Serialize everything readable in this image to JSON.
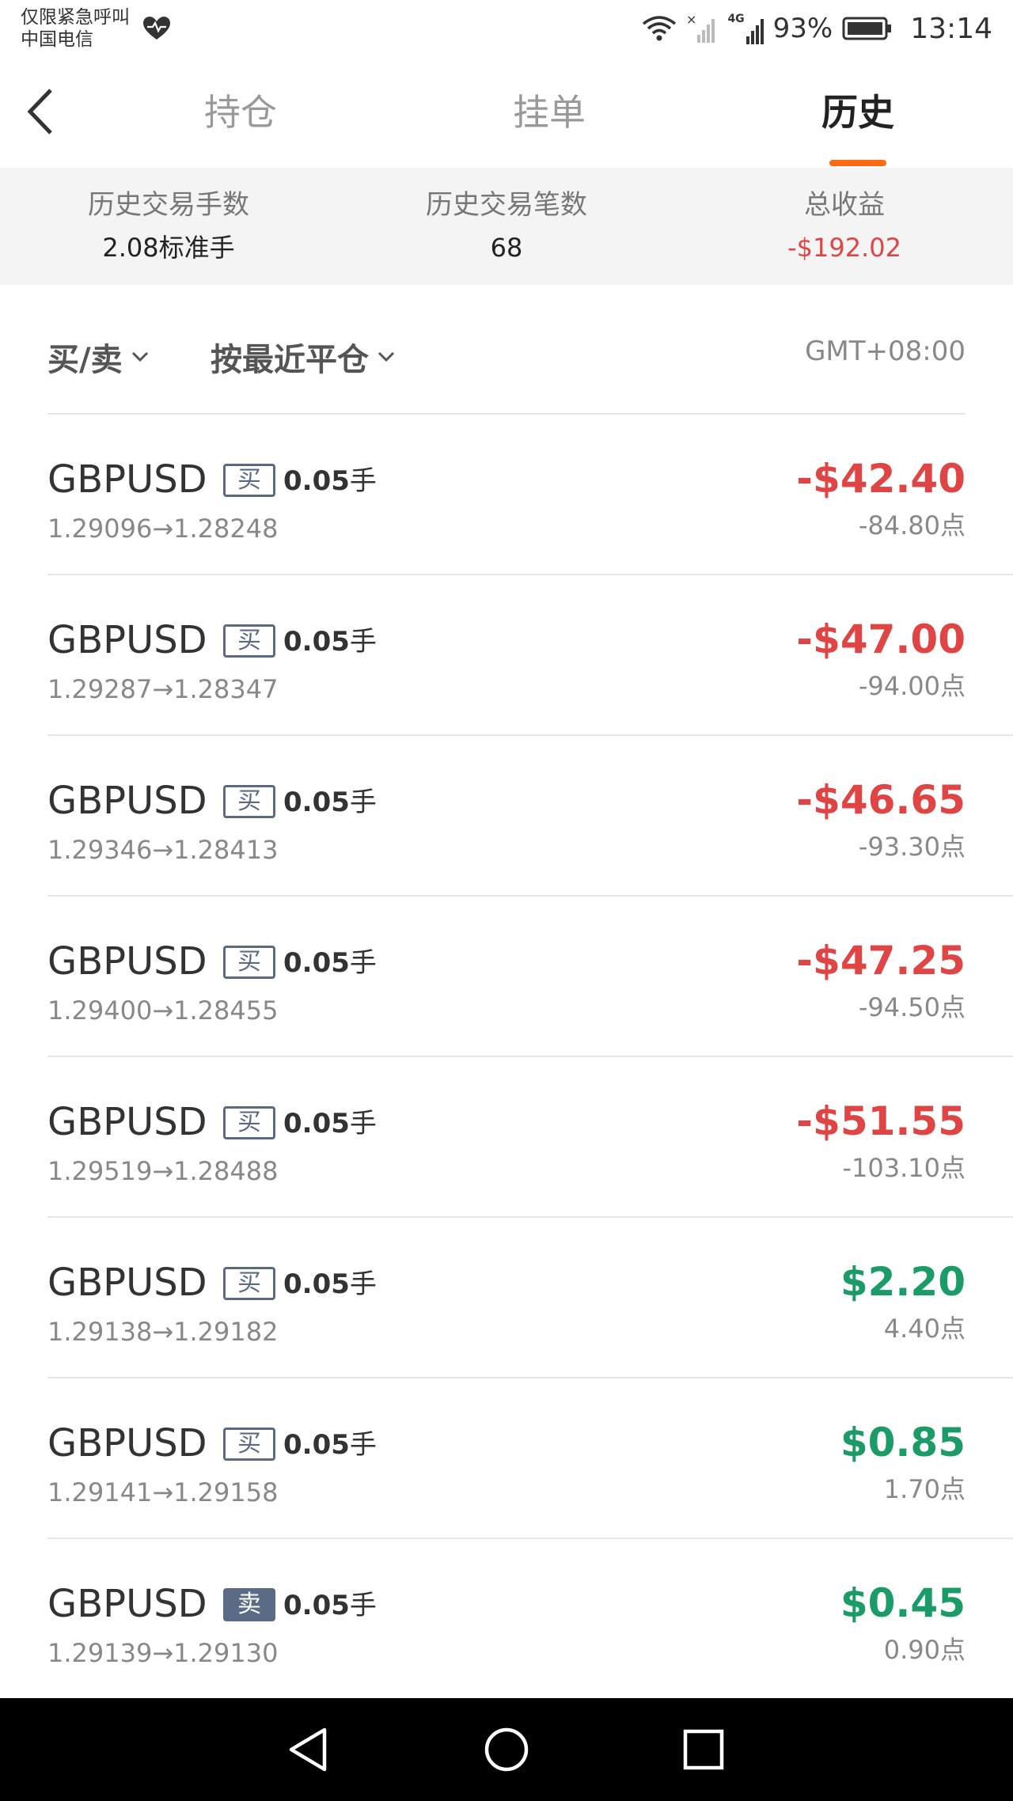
{
  "status_bar": {
    "carrier_line1": "仅限紧急呼叫",
    "carrier_line2": "中国电信",
    "network_label": "4G",
    "battery": "93%",
    "time": "13:14"
  },
  "header": {
    "tabs": [
      {
        "label": "持仓"
      },
      {
        "label": "挂单"
      },
      {
        "label": "历史"
      }
    ],
    "active_tab": "历史"
  },
  "summary": {
    "lots_label": "历史交易手数",
    "lots_value": "2.08标准手",
    "count_label": "历史交易笔数",
    "count_value": "68",
    "pnl_label": "总收益",
    "pnl_value": "-$192.02"
  },
  "filters": {
    "side_label": "买/卖",
    "sort_label": "按最近平仓",
    "timezone": "GMT+08:00"
  },
  "trades": [
    {
      "symbol": "GBPUSD",
      "side": "买",
      "lots": "0.05",
      "lots_unit": "手",
      "prices": "1.29096→1.28248",
      "pnl": "-$42.40",
      "points": "-84.80点"
    },
    {
      "symbol": "GBPUSD",
      "side": "买",
      "lots": "0.05",
      "lots_unit": "手",
      "prices": "1.29287→1.28347",
      "pnl": "-$47.00",
      "points": "-94.00点"
    },
    {
      "symbol": "GBPUSD",
      "side": "买",
      "lots": "0.05",
      "lots_unit": "手",
      "prices": "1.29346→1.28413",
      "pnl": "-$46.65",
      "points": "-93.30点"
    },
    {
      "symbol": "GBPUSD",
      "side": "买",
      "lots": "0.05",
      "lots_unit": "手",
      "prices": "1.29400→1.28455",
      "pnl": "-$47.25",
      "points": "-94.50点"
    },
    {
      "symbol": "GBPUSD",
      "side": "买",
      "lots": "0.05",
      "lots_unit": "手",
      "prices": "1.29519→1.28488",
      "pnl": "-$51.55",
      "points": "-103.10点"
    },
    {
      "symbol": "GBPUSD",
      "side": "买",
      "lots": "0.05",
      "lots_unit": "手",
      "prices": "1.29138→1.29182",
      "pnl": "$2.20",
      "points": "4.40点"
    },
    {
      "symbol": "GBPUSD",
      "side": "买",
      "lots": "0.05",
      "lots_unit": "手",
      "prices": "1.29141→1.29158",
      "pnl": "$0.85",
      "points": "1.70点"
    },
    {
      "symbol": "GBPUSD",
      "side": "卖",
      "lots": "0.05",
      "lots_unit": "手",
      "prices": "1.29139→1.29130",
      "pnl": "$0.45",
      "points": "0.90点"
    }
  ],
  "colors": {
    "accent": "#ff6a13",
    "loss": "#e04545",
    "profit": "#1a9b67",
    "badge": "#5b6a85"
  },
  "icons": {
    "back": "chevron-left-icon",
    "heart": "heart-pulse-icon",
    "wifi": "wifi-icon",
    "signal": "signal-icon",
    "battery": "battery-icon",
    "nav_back": "triangle-back-icon",
    "nav_home": "circle-home-icon",
    "nav_recent": "square-recent-icon"
  }
}
